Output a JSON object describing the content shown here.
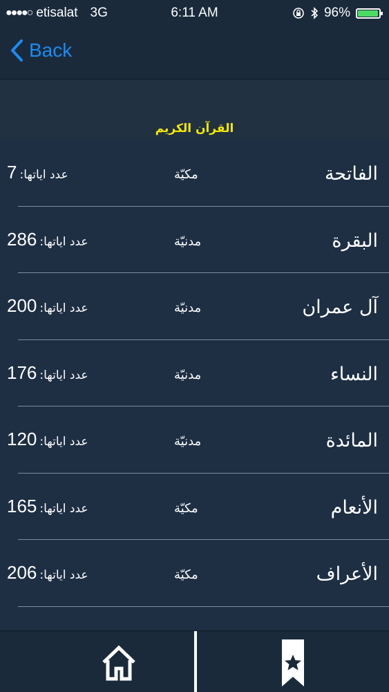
{
  "status_bar": {
    "signal": "●●●●○",
    "carrier": "etisalat",
    "network": "3G",
    "time": "6:11 AM",
    "battery": "96%",
    "battery_level": 0.96
  },
  "nav": {
    "back_label": "Back"
  },
  "header": {
    "title": "القرآن الكريم"
  },
  "verse_label": "عدد اياتها:",
  "surahs": [
    {
      "name": "الفاتحة",
      "type": "مكيّة",
      "verses": "7"
    },
    {
      "name": "البقرة",
      "type": "مدنيّة",
      "verses": "286"
    },
    {
      "name": "آل عمران",
      "type": "مدنيّة",
      "verses": "200"
    },
    {
      "name": "النساء",
      "type": "مدنيّة",
      "verses": "176"
    },
    {
      "name": "المائدة",
      "type": "مدنيّة",
      "verses": "120"
    },
    {
      "name": "الأنعام",
      "type": "مكيّة",
      "verses": "165"
    },
    {
      "name": "الأعراف",
      "type": "مكيّة",
      "verses": "206"
    }
  ],
  "tab_bar": {
    "home_icon": "home-icon",
    "bookmark_icon": "bookmark-star-icon"
  },
  "colors": {
    "accent": "#1b8bf2",
    "title": "#f2e800",
    "battery": "#4cd964"
  }
}
